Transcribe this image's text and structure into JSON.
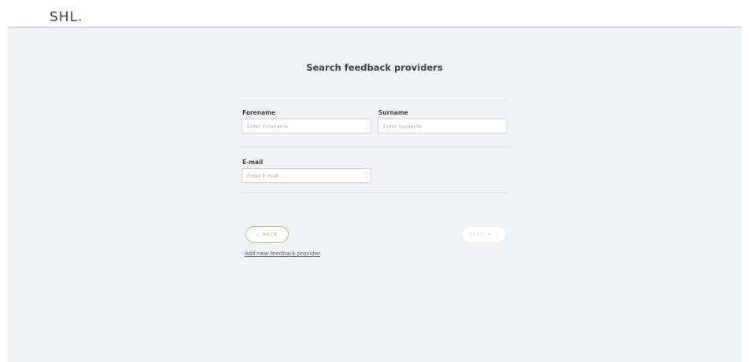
{
  "header": {
    "logo_text": "SHL"
  },
  "page": {
    "title": "Search feedback providers"
  },
  "form": {
    "forename": {
      "label": "Forename",
      "placeholder": "Enter Forename",
      "value": ""
    },
    "surname": {
      "label": "Surname",
      "placeholder": "Enter Surname",
      "value": ""
    },
    "email": {
      "label": "E-mail",
      "placeholder": "Enter E-mail",
      "value": ""
    }
  },
  "actions": {
    "back_label": "BACK",
    "search_label": "SEARCH",
    "add_link_label": "Add new feedback provider"
  },
  "icons": {
    "back": "chevron-left-icon",
    "search": "chevron-right-icon"
  },
  "colors": {
    "brand_green": "#6abf3f",
    "background": "#f1f2f4"
  }
}
